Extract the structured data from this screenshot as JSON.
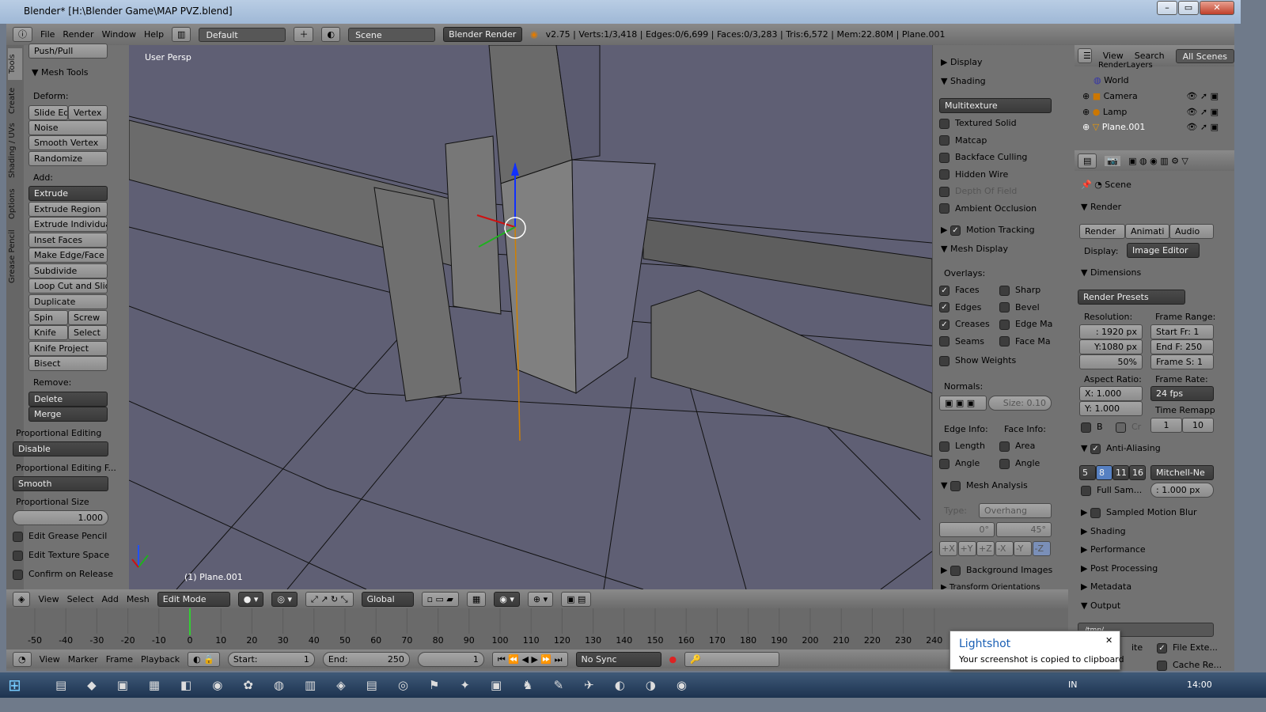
{
  "window": {
    "title": "Blender* [H:\\Blender Game\\MAP PVZ.blend]",
    "min": "–",
    "max": "▭",
    "close": "✕"
  },
  "info": {
    "menus": [
      "File",
      "Render",
      "Window",
      "Help"
    ],
    "layout": "Default",
    "scene": "Scene",
    "engine": "Blender Render",
    "stats": "v2.75 | Verts:1/3,418 | Edges:0/6,699 | Faces:0/3,283 | Tris:6,572 | Mem:22.80M | Plane.001"
  },
  "tabs": [
    "Tools",
    "Create",
    "Shading / UVs",
    "Options",
    "Grease Pencil"
  ],
  "toolshelf": {
    "top_button": "Push/Pull",
    "panel": "Mesh Tools",
    "deform_label": "Deform:",
    "deform": [
      "Slide Ed",
      "Vertex",
      "Noise",
      "Smooth Vertex",
      "Randomize"
    ],
    "add_label": "Add:",
    "extrude": "Extrude",
    "add": [
      "Extrude Region",
      "Extrude Individual",
      "Inset Faces",
      "Make Edge/Face",
      "Subdivide",
      "Loop Cut and Slide",
      "Duplicate"
    ],
    "pairs": [
      [
        "Spin",
        "Screw"
      ],
      [
        "Knife",
        "Select"
      ]
    ],
    "more": [
      "Knife Project",
      "Bisect"
    ],
    "remove_label": "Remove:",
    "remove": [
      "Delete",
      "Merge"
    ],
    "prop_edit_label": "Proportional Editing",
    "prop_edit": "Disable",
    "prop_falloff_label": "Proportional Editing F...",
    "prop_falloff": "Smooth",
    "prop_size_label": "Proportional Size",
    "prop_size": "1.000",
    "checks": [
      "Edit Grease Pencil",
      "Edit Texture Space",
      "Confirm on Release"
    ]
  },
  "viewport": {
    "view_name": "User Persp",
    "object": "(1) Plane.001"
  },
  "npanel": {
    "display": "Display",
    "shading": "Shading",
    "shading_mode": "Multitexture",
    "shading_opts": [
      {
        "label": "Textured Solid",
        "on": false
      },
      {
        "label": "Matcap",
        "on": false
      },
      {
        "label": "Backface Culling",
        "on": false
      },
      {
        "label": "Hidden Wire",
        "on": false
      },
      {
        "label": "Depth Of Field",
        "on": false
      },
      {
        "label": "Ambient Occlusion",
        "on": false
      }
    ],
    "motion": "Motion Tracking",
    "mesh_display": "Mesh Display",
    "overlays": "Overlays:",
    "ov_left": [
      {
        "label": "Faces",
        "on": true
      },
      {
        "label": "Edges",
        "on": true
      },
      {
        "label": "Creases",
        "on": true
      },
      {
        "label": "Seams",
        "on": false
      }
    ],
    "ov_right": [
      {
        "label": "Sharp",
        "on": false
      },
      {
        "label": "Bevel",
        "on": false
      },
      {
        "label": "Edge Ma",
        "on": false
      },
      {
        "label": "Face Ma",
        "on": false
      }
    ],
    "weights": "Show Weights",
    "normals": "Normals:",
    "size": "Size:  0.10",
    "edge_info": "Edge Info:",
    "face_info": "Face Info:",
    "edge_items": [
      "Length",
      "Angle"
    ],
    "face_items": [
      "Area",
      "Angle"
    ],
    "analysis": "Mesh Analysis",
    "type_label": "Type:",
    "type": "Overhang",
    "deg0": "0°",
    "deg45": "45°",
    "axes": [
      "+X",
      "+Y",
      "+Z",
      "-X",
      "-Y",
      "-Z"
    ],
    "bg": "Background Images",
    "transform": "Transform Orientations"
  },
  "outliner": {
    "menus": [
      "View",
      "Search"
    ],
    "filter": "All Scenes",
    "items": [
      "RenderLayers",
      "World",
      "Camera",
      "Lamp",
      "Plane.001"
    ]
  },
  "props": {
    "scene": "Scene",
    "render": "Render",
    "render_btns": [
      "Render",
      "Animati",
      "Audio"
    ],
    "display_label": "Display:",
    "display": "Image Editor",
    "dimensions": "Dimensions",
    "presets": "Render Presets",
    "resolution": "Resolution:",
    "res_x": ":  1920 px",
    "res_y": "Y:1080 px",
    "res_pct": "50%",
    "frame_range": "Frame Range:",
    "start": "Start Fr:  1",
    "end": "End F: 250",
    "step": "Frame S: 1",
    "aspect": "Aspect Ratio:",
    "ax": "X:   1.000",
    "ay": "Y:   1.000",
    "frame_rate": "Frame Rate:",
    "fps": "24 fps",
    "remap": "Time Remapp",
    "remap_old": "1",
    "remap_new": "10",
    "b": "B",
    "cr": "Cr",
    "aa": "Anti-Aliasing",
    "aa_samples": [
      "5",
      "8",
      "11",
      "16"
    ],
    "aa_selected": "8",
    "filter": "Mitchell-Ne",
    "full": "Full Sam...",
    "filter_size": ":  1.000 px",
    "sections": [
      "Sampled Motion Blur",
      "Shading",
      "Performance",
      "Post Processing",
      "Metadata",
      "Output"
    ],
    "output_path": "/tmp/",
    "file_ext": "File Exte...",
    "overwrite": "ite",
    "cache": "Cache Re..."
  },
  "header3d": {
    "menus": [
      "View",
      "Select",
      "Add",
      "Mesh"
    ],
    "mode": "Edit Mode",
    "orientation": "Global"
  },
  "timeline": {
    "ticks": [
      -50,
      -40,
      -30,
      -20,
      -10,
      0,
      10,
      20,
      30,
      40,
      50,
      60,
      70,
      80,
      90,
      100,
      110,
      120,
      130,
      140,
      150,
      160,
      170,
      180,
      190,
      200,
      210,
      220,
      230,
      240
    ],
    "current": 0
  },
  "tlheader": {
    "menus": [
      "View",
      "Marker",
      "Frame",
      "Playback"
    ],
    "start": "Start:",
    "start_val": "1",
    "end": "End:",
    "end_val": "250",
    "current": "1",
    "sync": "No Sync"
  },
  "toast": {
    "title": "Lightshot",
    "msg": "Your screenshot is copied to clipboard"
  },
  "taskbar": {
    "lang": "IN",
    "time": "14:00"
  },
  "colors": {
    "accent": "#5680c2",
    "viewport": "#5f5f74",
    "panel": "#727272"
  }
}
